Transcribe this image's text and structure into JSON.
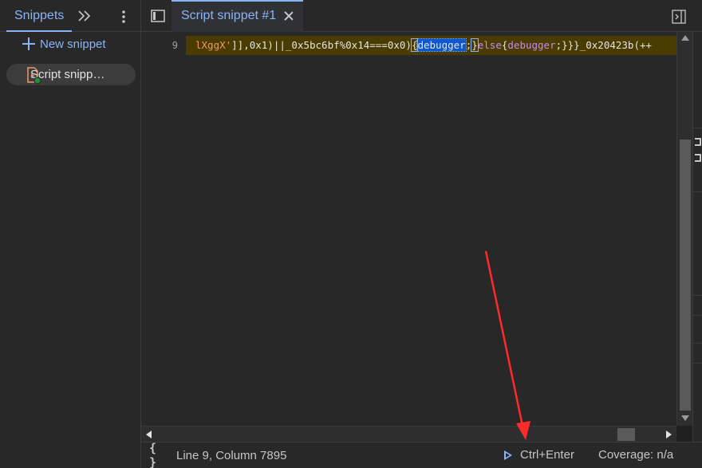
{
  "sidebar": {
    "tab_label": "Snippets",
    "more_tabs_icon": "chevron-double-right-icon",
    "menu_icon": "kebab-menu-icon",
    "new_snippet_label": "New snippet",
    "snippets": [
      {
        "label": "Script snipp…",
        "icon": "script-file-icon"
      }
    ]
  },
  "editor": {
    "toggle_navigator_icon": "toggle-navigator-icon",
    "tab_label": "Script snippet #1",
    "toggle_debugger_icon": "toggle-debugger-icon",
    "line_number": "9",
    "code": {
      "seg1": "lXggX'",
      "seg2": "]],0x1)||_0x5bc6bf%0x14===0x0)",
      "seg3": "{",
      "seg4": "debugger",
      "seg5": ";",
      "seg6": "}",
      "seg7": "else",
      "seg8": "{",
      "seg9": "debugger",
      "seg10": ";}}}_0x20423b(++"
    }
  },
  "status_bar": {
    "pretty_print_label": "{ }",
    "cursor_position": "Line 9, Column 7895",
    "run_shortcut": "Ctrl+Enter",
    "coverage": "Coverage: n/a"
  },
  "colors": {
    "accent": "#8ab4f8",
    "annotation": "#ff2a2a",
    "highlight_line": "#4a3b00"
  }
}
